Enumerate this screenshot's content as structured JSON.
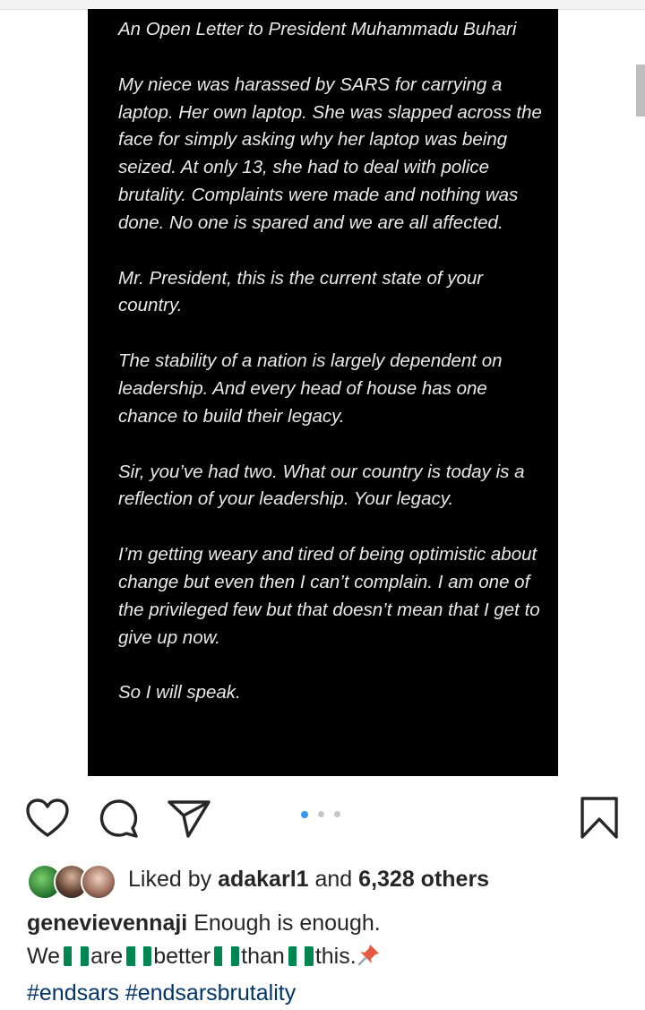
{
  "post": {
    "letter_paragraphs": [
      "An Open Letter to President Muhammadu Buhari",
      "My niece was harassed by SARS for carrying a laptop. Her own laptop. She was slapped across the face for simply asking why her laptop was being seized. At only 13, she had to deal with police brutality. Complaints were made and nothing was done. No one is spared and we are all affected.",
      "Mr. President, this is the current state of your country.",
      "The stability of a nation is largely dependent on leadership. And every head of house has one chance to build their legacy.",
      "Sir, you’ve had two. What our country is today is a reflection of your leadership. Your legacy.",
      "I’m getting weary and tired of being optimistic about change but even then I can’t complain. I am one of the privileged few but that doesn’t mean that I get to give up now.",
      "So I will speak."
    ],
    "carousel": {
      "total": 3,
      "active": 0
    }
  },
  "actions": {
    "like_icon": "heart-outline-icon",
    "comment_icon": "speech-bubble-icon",
    "share_icon": "paper-plane-icon",
    "save_icon": "bookmark-icon"
  },
  "likes": {
    "prefix": "Liked by",
    "user": "adakarl1",
    "connector": "and",
    "others": "6,328 others"
  },
  "caption": {
    "username": "genevievennaji",
    "text": "Enough is enough.",
    "line2": [
      "We",
      "are",
      "better",
      "than",
      "this."
    ],
    "flag_emoji": "nigeria-flag-icon",
    "pin_emoji": "pushpin-icon",
    "hashtags": [
      "#endsars",
      "#endsarsbrutality"
    ]
  },
  "colors": {
    "text": "#262626",
    "hashtag": "#003569",
    "dot_active": "#3897f0",
    "dot_inactive": "#c7c7c7",
    "flag_green": "#008751",
    "flag_white": "#ffffff",
    "pin_red": "#e8573f"
  }
}
